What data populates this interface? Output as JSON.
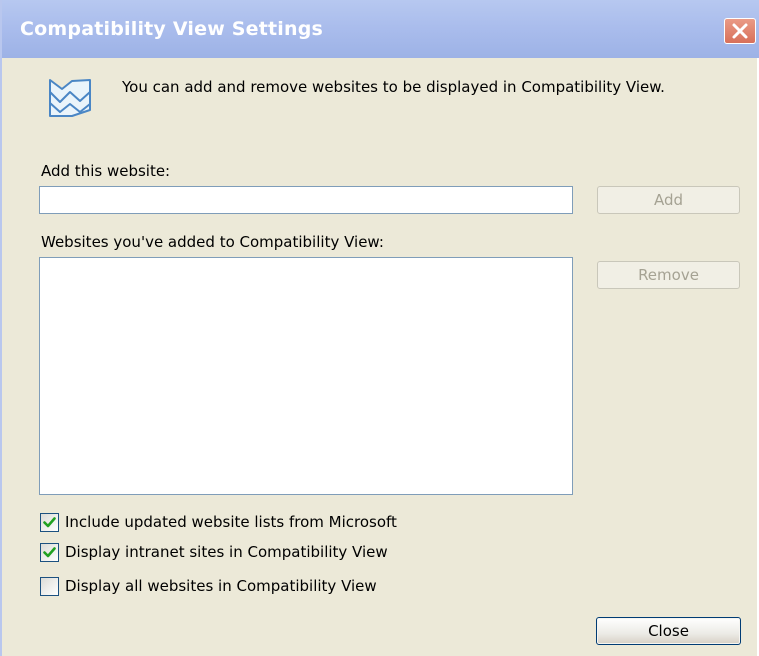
{
  "window": {
    "title": "Compatibility View Settings",
    "close_icon": "close-x-icon"
  },
  "info": {
    "icon": "compatibility-view-icon",
    "text": "You can add and remove websites to be displayed in Compatibility View."
  },
  "add_site": {
    "label": "Add this website:",
    "value": "",
    "placeholder": "",
    "add_button": "Add",
    "add_button_enabled": false
  },
  "site_list": {
    "label": "Websites you've added to Compatibility View:",
    "items": [],
    "remove_button": "Remove",
    "remove_button_enabled": false
  },
  "options": [
    {
      "label": "Include updated website lists from Microsoft",
      "checked": true
    },
    {
      "label": "Display intranet sites in Compatibility View",
      "checked": true
    },
    {
      "label": "Display all websites in Compatibility View",
      "checked": false
    }
  ],
  "footer": {
    "close_button": "Close"
  },
  "colors": {
    "title_bar": "#a9bcec",
    "dialog_bg": "#ece9d8",
    "close_button": "#d8705a",
    "checkmark": "#21a121"
  }
}
